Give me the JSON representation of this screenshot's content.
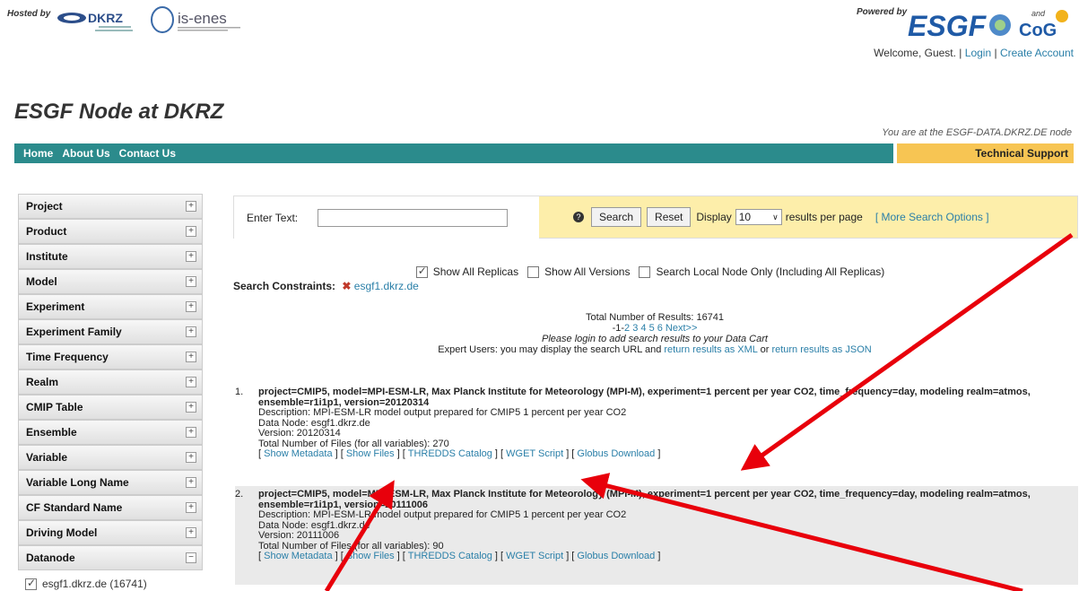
{
  "header": {
    "hosted_by": "Hosted by",
    "dkrz_logo_text": "DKRZ",
    "isenes_logo_text": "is-enes",
    "powered_by": "Powered by",
    "esgf_logo_text": "ESGF",
    "cog_logo_text": "CoG",
    "cog_and": "and",
    "welcome": "Welcome, Guest.",
    "sep1": " | ",
    "login": "Login",
    "sep2": " | ",
    "create_account": "Create Account"
  },
  "site": {
    "title": "ESGF Node at DKRZ",
    "node_note": "You are at the ESGF-DATA.DKRZ.DE node"
  },
  "nav": {
    "home": "Home",
    "about": "About Us",
    "contact": "Contact Us",
    "tech_support": "Technical Support"
  },
  "facets": [
    {
      "label": "Project",
      "state": "+"
    },
    {
      "label": "Product",
      "state": "+"
    },
    {
      "label": "Institute",
      "state": "+"
    },
    {
      "label": "Model",
      "state": "+"
    },
    {
      "label": "Experiment",
      "state": "+"
    },
    {
      "label": "Experiment Family",
      "state": "+"
    },
    {
      "label": "Time Frequency",
      "state": "+"
    },
    {
      "label": "Realm",
      "state": "+"
    },
    {
      "label": "CMIP Table",
      "state": "+"
    },
    {
      "label": "Ensemble",
      "state": "+"
    },
    {
      "label": "Variable",
      "state": "+"
    },
    {
      "label": "Variable Long Name",
      "state": "+"
    },
    {
      "label": "CF Standard Name",
      "state": "+"
    },
    {
      "label": "Driving Model",
      "state": "+"
    },
    {
      "label": "Datanode",
      "state": "−"
    }
  ],
  "datanode_value": "esgf1.dkrz.de (16741)",
  "search": {
    "label": "Enter Text:",
    "value": "",
    "help": "?",
    "search_btn": "Search",
    "reset_btn": "Reset",
    "display_label": "Display",
    "display_value": "10",
    "per_page": "results per page",
    "more_options": "[ More Search Options ]"
  },
  "options": {
    "show_all_replicas": "Show All Replicas",
    "show_all_versions": "Show All Versions",
    "search_local": "Search Local Node Only (Including All Replicas)",
    "constraints_label": "Search Constraints:",
    "constraint_value": "esgf1.dkrz.de"
  },
  "summary": {
    "total": "Total Number of Results: 16741",
    "pages_prefix": "-1-",
    "pages": "2 3 4 5 6 Next>>",
    "login_note": "Please login to add search results to your Data Cart",
    "expert_prefix": "Expert Users: you may display the search URL and ",
    "xml_link": "return results as XML",
    "or": " or ",
    "json_link": "return results as JSON"
  },
  "results": [
    {
      "num": "1.",
      "title": "project=CMIP5, model=MPI-ESM-LR, Max Planck Institute for Meteorology (MPI-M), experiment=1 percent per year CO2, time_frequency=day, modeling realm=atmos, ensemble=r1i1p1, version=20120314",
      "description": "Description: MPI-ESM-LR model output prepared for CMIP5 1 percent per year CO2",
      "data_node": "Data Node: esgf1.dkrz.de",
      "version": "Version: 20120314",
      "files": "Total Number of Files (for all variables): 270",
      "links": [
        "Show Metadata",
        "Show Files",
        "THREDDS Catalog",
        "WGET Script",
        "Globus Download"
      ]
    },
    {
      "num": "2.",
      "title": "project=CMIP5, model=MPI-ESM-LR, Max Planck Institute for Meteorology (MPI-M), experiment=1 percent per year CO2, time_frequency=day, modeling realm=atmos, ensemble=r1i1p1, version=20111006",
      "description": "Description: MPI-ESM-LR model output prepared for CMIP5 1 percent per year CO2",
      "data_node": "Data Node: esgf1.dkrz.de",
      "version": "Version: 20111006",
      "files": "Total Number of Files (for all variables): 90",
      "links": [
        "Show Metadata",
        "Show Files",
        "THREDDS Catalog",
        "WGET Script",
        "Globus Download"
      ]
    }
  ],
  "colors": {
    "nav_bg": "#2b8b8c",
    "tech_bg": "#f7c553",
    "search_bg": "#fdeeaa",
    "link": "#2a7fa8",
    "annotation_arrow": "#e8000b"
  }
}
